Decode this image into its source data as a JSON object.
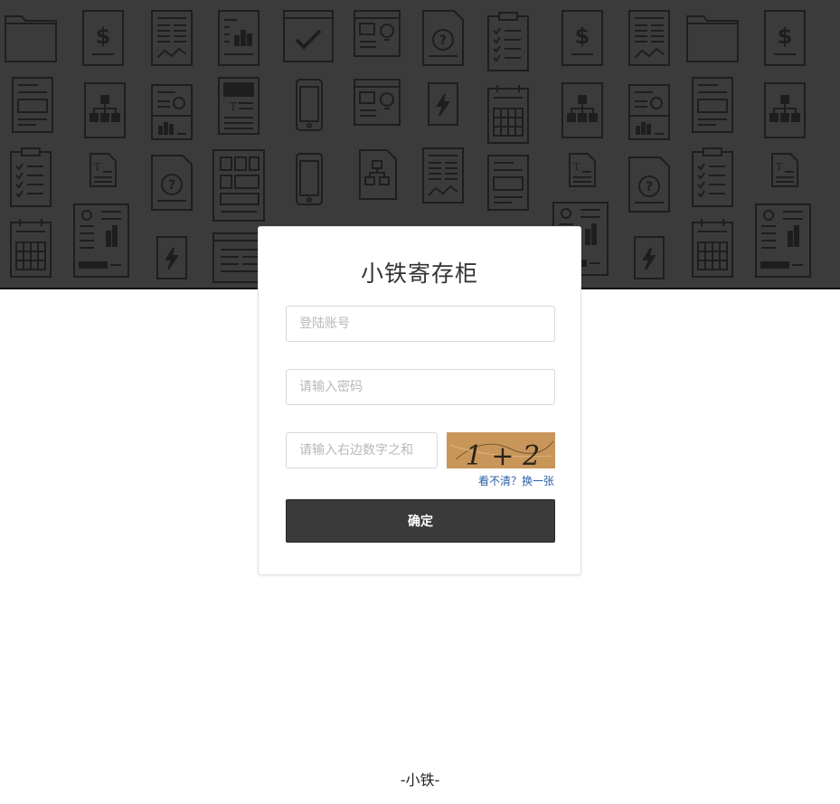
{
  "app": {
    "title": "小铁寄存柜"
  },
  "form": {
    "username_placeholder": "登陆账号",
    "password_placeholder": "请输入密码",
    "captcha_placeholder": "请输入右边数字之和",
    "captcha_text": "1 + 2",
    "refresh_label": "看不清？换一张",
    "submit_label": "确定"
  },
  "footer": {
    "text": "-小铁-"
  },
  "colors": {
    "banner_bg": "#3b3b3b",
    "banner_icon": "#1f1f1f",
    "button_bg": "#3a3a3a",
    "link": "#2a5fa8",
    "captcha_bg": "#c9965a"
  }
}
